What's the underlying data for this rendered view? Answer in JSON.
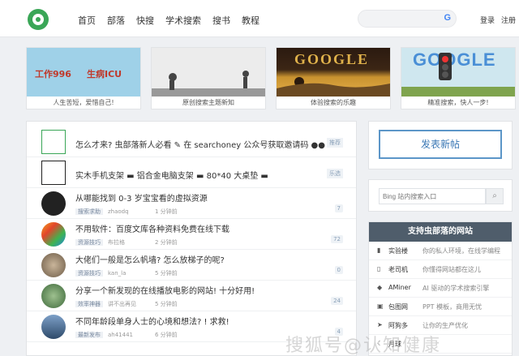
{
  "nav": [
    "首页",
    "部落",
    "快搜",
    "学术搜索",
    "搜书",
    "教程"
  ],
  "header": {
    "login": "登录",
    "register": "注册"
  },
  "banners": [
    {
      "caption": "人生苦短，爱惜自己!",
      "t1": "工作996",
      "t2": "生病ICU"
    },
    {
      "caption": "原创搜索主题新知"
    },
    {
      "caption": "体验搜索的乐趣",
      "logo": "GOOGLE"
    },
    {
      "caption": "精准搜索，快人一步!",
      "logo": "GOOGLE"
    }
  ],
  "posts": [
    {
      "title": "怎么才来? 虫部落新人必看  ✎    在 searchoney 公众号获取邀请码  ●●",
      "badge": "推荐"
    },
    {
      "title": "实木手机支架  ▬    铝合金电脑支架  ▬    80*40 大桌垫  ▬",
      "badge": "乐选"
    },
    {
      "title": "从哪能找到 0-3 岁宝宝看的虚拟资源",
      "tag": "搜索求助",
      "author": "zhaodq",
      "time": "1 分钟前",
      "count": "7"
    },
    {
      "title": "不用软件：百度文库各种资料免费在线下载",
      "tag": "资源技巧",
      "author": "布拉格",
      "time": "2 分钟前",
      "count": "72"
    },
    {
      "title": "大佬们一般是怎么帆墙? 怎么放梯子的呢?",
      "tag": "资源技巧",
      "author": "kan_la",
      "time": "5 分钟前",
      "count": "0"
    },
    {
      "title": "分享一个新发现的在线播放电影的网站! 十分好用!",
      "tag": "效率神器",
      "author": "讲不出再见",
      "time": "5 分钟前",
      "count": "24"
    },
    {
      "title": "不同年龄段单身人士的心境和想法? ! 求救!",
      "tag": "最新发布",
      "author": "ah41441",
      "time": "6 分钟前",
      "count": "4"
    }
  ],
  "sidebar": {
    "post_button": "发表新帖",
    "search_placeholder": "Bing 站内搜索入口",
    "support_title": "支持虫部落的网站",
    "sites": [
      {
        "name": "实验楼",
        "desc": "你的私人环境，在线学编程"
      },
      {
        "name": "老司机",
        "desc": "你懂得网站都在这儿"
      },
      {
        "name": "AMiner",
        "desc": "AI 驱动的学术搜索引擎"
      },
      {
        "name": "包图网",
        "desc": "PPT 模板，商用无忧"
      },
      {
        "name": "阿狗多",
        "desc": "让你的生产优化"
      },
      {
        "name": "月球",
        "desc": ""
      }
    ]
  },
  "watermark": "搜狐号@认知健康",
  "colors": {
    "accent": "#3aa657",
    "support_header": "#4f5d6b",
    "button": "#3b78b5"
  }
}
